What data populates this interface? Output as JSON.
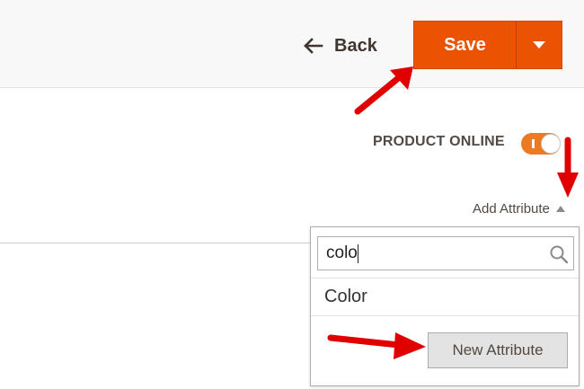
{
  "header": {
    "back_label": "Back",
    "save_label": "Save"
  },
  "product": {
    "online_label": "PRODUCT ONLINE",
    "online_enabled": true
  },
  "attributes": {
    "add_label": "Add Attribute",
    "search_value": "colo",
    "options": [
      "Color"
    ],
    "new_button_label": "New Attribute"
  },
  "colors": {
    "accent": "#eb5202",
    "annotation_arrow": "#e00000"
  },
  "icons": [
    "back-arrow-icon",
    "chevron-down-icon",
    "search-icon",
    "caret-up-icon"
  ]
}
